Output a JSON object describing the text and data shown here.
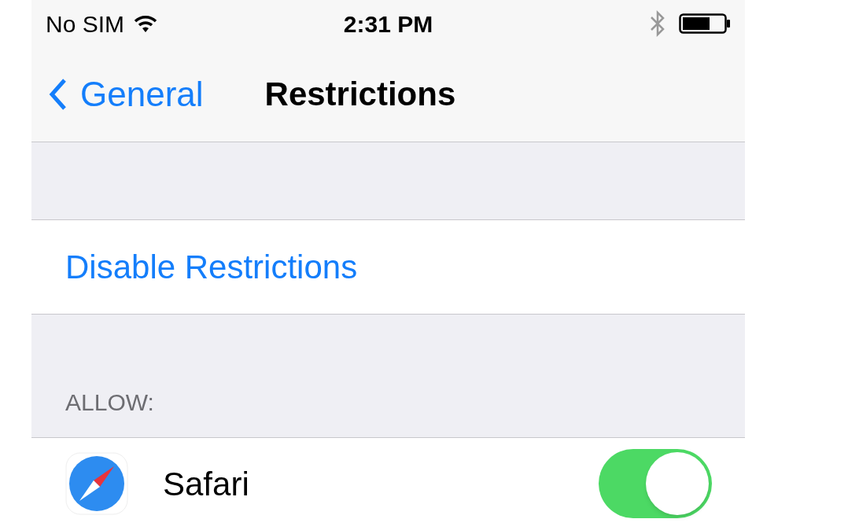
{
  "status_bar": {
    "carrier": "No SIM",
    "time": "2:31 PM"
  },
  "nav": {
    "back": "General",
    "title": "Restrictions"
  },
  "actions": [
    {
      "label": "Disable Restrictions"
    }
  ],
  "section": {
    "header": "ALLOW:"
  },
  "allow_items": [
    {
      "label": "Safari",
      "on": true
    }
  ]
}
